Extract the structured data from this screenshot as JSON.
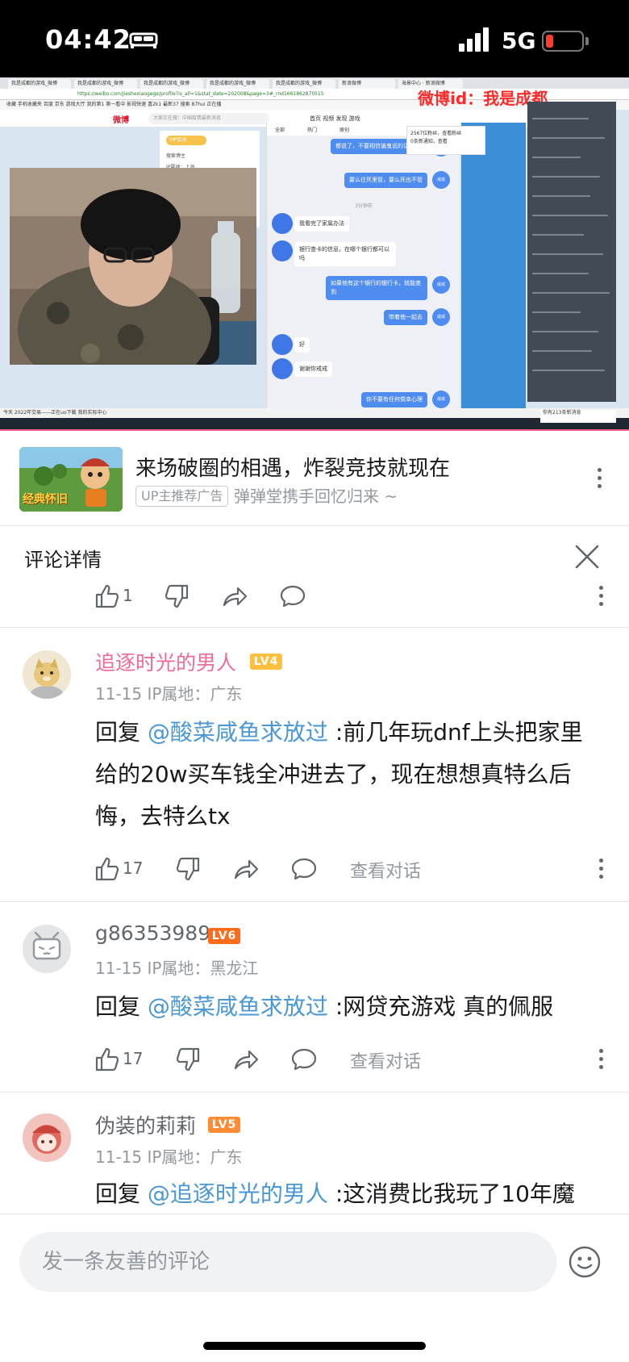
{
  "status_bar": {
    "time": "04:42",
    "network": "5G",
    "battery_level": 0.2
  },
  "video": {
    "browser_tabs": [
      "我是成都的游戏_微博",
      "我是成都的游戏_微博",
      "我是成都的游戏_微博",
      "我是成都的游戏_微博",
      "我是成都的游戏_微博",
      "新浪微博",
      "海景中心 · 新浪微博"
    ],
    "url": "https://weibo.com/jieshexiaogege/profile?is_all=1&stat_date=202008&page=3#_rnd1661862870515",
    "bookmarks": "收藏  手机收藏夹  百度  京东  游戏大厅  我的第1  第一看中  影视快速  喜2k1  最新37  搜索  87hui  正在播",
    "watermark": "微博id：我是成都",
    "weibo_logo": "微博",
    "weibo_search": "大家正在搜：中国疫情最新消息",
    "weibo_nav": "首页   视频   发现   游戏",
    "profile_tag": "VIP会员",
    "profile_lines": [
      "搜索博主",
      "IP属地：上海"
    ],
    "chat_tabs": [
      "全部",
      "热门",
      "原创"
    ],
    "chat_separator": "3分钟前",
    "messages_right": [
      "都说了，不要相信骗鬼说的话。",
      "要么往死里管，要么死也不管",
      "如果他有这个银行的银行卡，就能查到",
      "带着他一起去",
      "你不要有任何侥幸心理"
    ],
    "messages_left": [
      "我看完了家属办法",
      "银行查卡的信息，在哪个银行都可以吗",
      "好",
      "谢谢你戒戒"
    ],
    "avatar_label": "戒戒",
    "popup": [
      "2567位粉丝，查看粉丝",
      "0条新通知，查看"
    ],
    "taskbar_top": "今天  2022年交易——正在uo下载  我的实际中心",
    "taskbar_notice": [
      "你有213条新消息"
    ]
  },
  "ad": {
    "thumb_label": "经典怀旧",
    "title": "来场破圈的相遇，炸裂竞技就现在",
    "badge": "UP主推荐广告",
    "subtitle": "弹弹堂携手回忆归来 ~"
  },
  "detail": {
    "title": "评论详情",
    "like_count": "1"
  },
  "comments": [
    {
      "name": "追逐时光的男人",
      "name_color": "#f06b94",
      "level": "LV4",
      "level_color": "#ffbf3f",
      "meta": "11-15  IP属地：广东",
      "prefix": "回复 ",
      "mention": "@酸菜咸鱼求放过",
      "text": " :前几年玩dnf上头把家里给的20w买车钱全冲进去了，现在想想真特么后悔，去特么tx",
      "likes": "17",
      "view_dialog": "查看对话"
    },
    {
      "name": "g86353989",
      "name_color": "#61666d",
      "level": "LV6",
      "level_color": "#ff6c1a",
      "meta": "11-15  IP属地：黑龙江",
      "prefix": "回复 ",
      "mention": "@酸菜咸鱼求放过",
      "text": " :网贷充游戏  真的佩服",
      "likes": "17",
      "view_dialog": "查看对话"
    },
    {
      "name": "伪装的莉莉",
      "name_color": "#61666d",
      "level": "LV5",
      "level_color": "#ff8c33",
      "meta": "11-15  IP属地：广东",
      "prefix": "回复 ",
      "mention": "@追逐时光的男人",
      "text": " :这消费比我玩了10年魔"
    }
  ],
  "input": {
    "placeholder": "发一条友善的评论"
  }
}
